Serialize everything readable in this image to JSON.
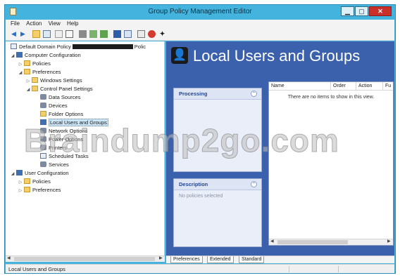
{
  "window": {
    "title": "Group Policy Management Editor",
    "accent": "#44b4df",
    "close_color": "#c9302c"
  },
  "menubar": [
    "File",
    "Action",
    "View",
    "Help"
  ],
  "toolbar_icons": [
    "back-icon",
    "forward-icon",
    "up-icon",
    "show-tree-icon",
    "copy-icon",
    "delete-icon",
    "new-icon",
    "properties-icon",
    "export-icon",
    "help-icon",
    "list-icon",
    "print-icon",
    "stop-icon",
    "add-icon"
  ],
  "tree": {
    "root_label": "Default Domain Policy",
    "root_suffix": "Polic",
    "nodes": [
      {
        "label": "Computer Configuration",
        "exp": "◢"
      },
      {
        "label": "Policies",
        "exp": "▷"
      },
      {
        "label": "Preferences",
        "exp": "◢"
      },
      {
        "label": "Windows Settings",
        "exp": "▷"
      },
      {
        "label": "Control Panel Settings",
        "exp": "◢"
      },
      {
        "label": "Data Sources"
      },
      {
        "label": "Devices"
      },
      {
        "label": "Folder Options"
      },
      {
        "label": "Local Users and Groups"
      },
      {
        "label": "Network Options"
      },
      {
        "label": "Power Options"
      },
      {
        "label": "Printers"
      },
      {
        "label": "Scheduled Tasks"
      },
      {
        "label": "Services"
      },
      {
        "label": "User Configuration",
        "exp": "◢"
      },
      {
        "label": "Policies",
        "exp": "▷"
      },
      {
        "label": "Preferences",
        "exp": "▷"
      }
    ]
  },
  "main": {
    "header_title": "Local Users and Groups",
    "header_color": "#3b61ad",
    "processing": {
      "title": "Processing"
    },
    "description": {
      "title": "Description",
      "body": "No policies selected"
    },
    "columns": [
      "Name",
      "Order",
      "Action",
      "Fu"
    ],
    "empty_text": "There are no items to show in this view."
  },
  "tabs": [
    "Preferences",
    "Extended",
    "Standard"
  ],
  "status": {
    "text": "Local Users and Groups"
  },
  "watermark": "Braindump2go.com"
}
